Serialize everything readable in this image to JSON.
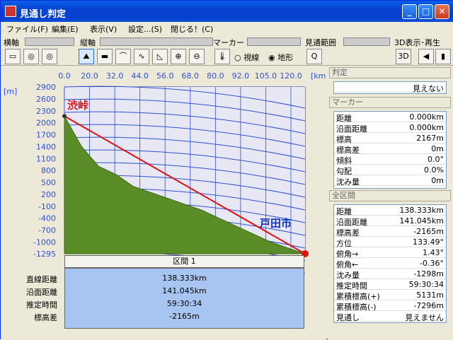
{
  "window": {
    "title": "見通し判定"
  },
  "menu": [
    "ファイル(F)",
    "編集(E)",
    "表示(V)",
    "設定...(S)",
    "閉じる！(C)"
  ],
  "toolbar": {
    "yoko": "横軸",
    "tate": "縦軸",
    "marker": "マーカー",
    "range": "見通範囲",
    "view3d": "3D表示･再生",
    "radio1": "視線",
    "radio2": "地形",
    "view3d_btn": "3D"
  },
  "chart_data": {
    "type": "area",
    "xlabel": "[km]",
    "ylabel": "[m]",
    "xticks": [
      "0.0",
      "20.0",
      "32.0",
      "44.0",
      "56.0",
      "68.0",
      "80.0",
      "92.0",
      "105.0",
      "120.0"
    ],
    "yticks": [
      "2900",
      "2600",
      "2300",
      "2000",
      "1700",
      "1400",
      "1100",
      "800",
      "500",
      "200",
      "-100",
      "-400",
      "-700",
      "-1000",
      "-1295"
    ],
    "ylim": [
      -1295,
      2900
    ],
    "start_label": "渋峠",
    "end_label": "戸田市",
    "series": [
      {
        "values": [
          2167,
          1400,
          900,
          700,
          400,
          250,
          100,
          -50,
          -200,
          -400,
          -600,
          -800,
          -1000,
          -1150,
          -1295
        ]
      }
    ]
  },
  "segment": {
    "header": "区間 1",
    "labels": [
      "直線距離",
      "沿面距離",
      "推定時間",
      "標高差"
    ],
    "values": [
      "138.333km",
      "141.045km",
      "59:30:34",
      "-2165m"
    ]
  },
  "right": {
    "judge_head": "判定",
    "judge_value": "見えない",
    "marker_head": "マーカー",
    "marker_rows": [
      [
        "距離",
        "0.000km"
      ],
      [
        "沿面距離",
        "0.000km"
      ],
      [
        "標高",
        "2167m"
      ],
      [
        "標高差",
        "0m"
      ],
      [
        "傾斜",
        "0.0°"
      ],
      [
        "勾配",
        "0.0%"
      ],
      [
        "沈み量",
        "0m"
      ]
    ],
    "all_head": "全区間",
    "all_rows": [
      [
        "距離",
        "138.333km"
      ],
      [
        "沿面距離",
        "141.045km"
      ],
      [
        "標高差",
        "-2165m"
      ],
      [
        "方位",
        "133.49°"
      ],
      [
        "俯角→",
        "1.43°"
      ],
      [
        "俯角←",
        "-0.36°"
      ],
      [
        "沈み量",
        "-1298m"
      ],
      [
        "推定時間",
        "59:30:34"
      ],
      [
        "累積標高(+)",
        "5131m"
      ],
      [
        "累積標高(-)",
        "-7296m"
      ],
      [
        "見通し",
        "見えません"
      ]
    ]
  }
}
